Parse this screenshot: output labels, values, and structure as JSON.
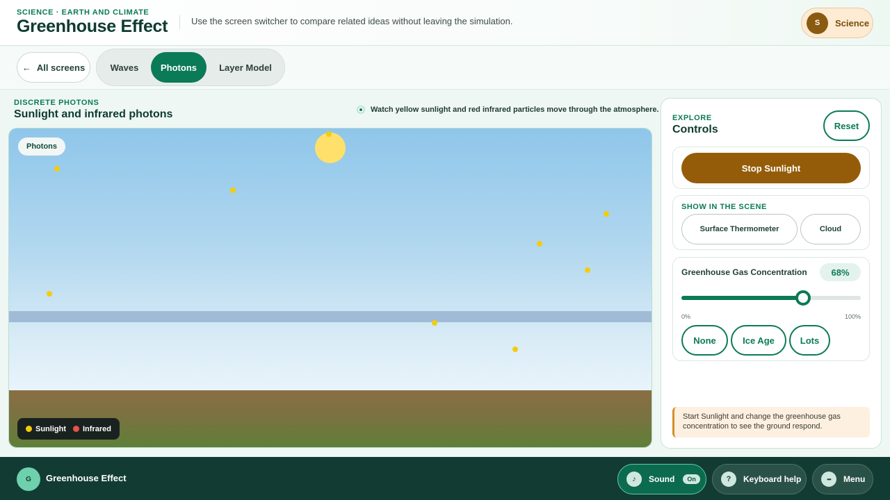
{
  "header": {
    "eyebrow": "SCIENCE · EARTH AND CLIMATE",
    "title": "Greenhouse Effect",
    "description": "Use the screen switcher to compare related ideas without leaving the simulation.",
    "subject": {
      "initial": "S",
      "label": "Science"
    }
  },
  "nav": {
    "back_label": "All screens",
    "tabs": [
      {
        "label": "Waves",
        "active": false
      },
      {
        "label": "Photons",
        "active": true
      },
      {
        "label": "Layer Model",
        "active": false
      }
    ]
  },
  "scene": {
    "eyebrow": "DISCRETE PHOTONS",
    "title": "Sunlight and infrared photons",
    "hint": "Watch yellow sunlight and red infrared particles move through the atmosphere.",
    "label": "Photons",
    "legend": [
      {
        "label": "Sunlight",
        "color": "#f5cc0c"
      },
      {
        "label": "Infrared",
        "color": "#e5534b"
      }
    ]
  },
  "controls": {
    "eyebrow": "EXPLORE",
    "title": "Controls",
    "reset_label": "Reset",
    "stop_label": "Stop Sunlight",
    "show_heading": "SHOW IN THE SCENE",
    "show_options": [
      "Surface Thermometer",
      "Cloud"
    ],
    "gas": {
      "label": "Greenhouse Gas Concentration",
      "value": 68,
      "value_text": "68%",
      "min_label": "0%",
      "max_label": "100%",
      "presets": [
        "None",
        "Ice Age",
        "Lots"
      ]
    },
    "notice": "Start Sunlight and change the greenhouse gas concentration to see the ground respond."
  },
  "footer": {
    "initial": "G",
    "title": "Greenhouse Effect",
    "sound_label": "Sound",
    "sound_state": "On",
    "sound_icon": "♪",
    "keyboard_label": "Keyboard help",
    "keyboard_icon": "?",
    "menu_label": "Menu",
    "menu_icon": "•••"
  },
  "colors": {
    "accent": "#0b7a57",
    "sunlight_button": "#945c08",
    "footer_bg": "#123c33"
  }
}
